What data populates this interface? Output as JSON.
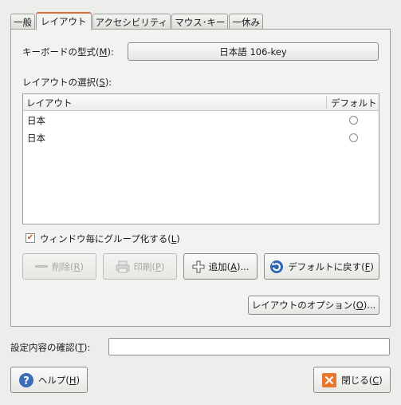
{
  "tabs": [
    {
      "label": "一般"
    },
    {
      "label": "レイアウト"
    },
    {
      "label": "アクセシビリティ"
    },
    {
      "label": "マウス･キー"
    },
    {
      "label": "一休み"
    }
  ],
  "keyboard_model": {
    "label": "キーボードの型式(",
    "mnemonic": "M",
    "label_end": "):",
    "value": "日本語 106-key"
  },
  "layout_select": {
    "label": "レイアウトの選択(",
    "mnemonic": "S",
    "label_end": "):"
  },
  "layout_table": {
    "columns": [
      "レイアウト",
      "デフォルト"
    ],
    "rows": [
      {
        "name": "日本",
        "default": false
      },
      {
        "name": "日本",
        "default": false
      }
    ]
  },
  "group_per_window": {
    "checked": true,
    "label": "ウィンドウ毎にグループ化する(",
    "mnemonic": "L",
    "label_end": ")"
  },
  "buttons": {
    "remove": {
      "label": "削除(",
      "mnemonic": "R",
      "end": ")"
    },
    "print": {
      "label": "印刷(",
      "mnemonic": "P",
      "end": ")"
    },
    "add": {
      "label": "追加(",
      "mnemonic": "A",
      "end": ")..."
    },
    "reset_default": {
      "label": "デフォルトに戻す(",
      "mnemonic": "F",
      "end": ")"
    },
    "layout_options": {
      "label": "レイアウトのオプション(",
      "mnemonic": "O",
      "end": ")..."
    },
    "help": {
      "label": "ヘルプ(",
      "mnemonic": "H",
      "end": ")"
    },
    "close": {
      "label": "閉じる(",
      "mnemonic": "C",
      "end": ")"
    }
  },
  "test_field": {
    "label": "設定内容の確認(",
    "mnemonic": "T",
    "label_end": "):",
    "value": ""
  },
  "colors": {
    "accent": "#d26d3e",
    "help_icon": "#3a6db5",
    "close_icon": "#e8762b"
  }
}
